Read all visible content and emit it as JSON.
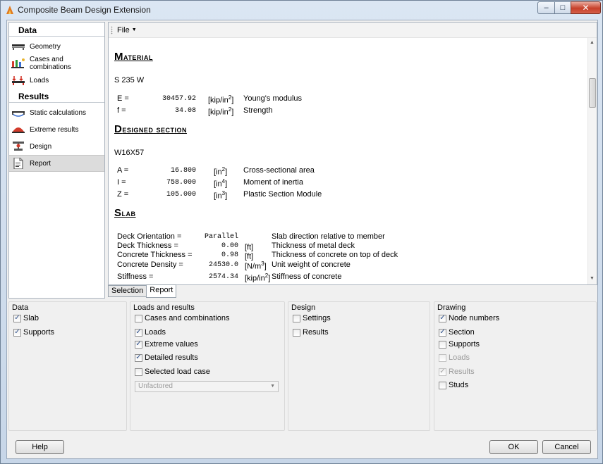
{
  "window": {
    "title": "Composite Beam Design Extension",
    "min_glyph": "–",
    "max_glyph": "□",
    "close_glyph": "✕"
  },
  "sidebar": {
    "data_header": "Data",
    "data_items": [
      {
        "label": "Geometry",
        "icon": "geometry-icon"
      },
      {
        "label": "Cases and combinations",
        "icon": "cases-icon"
      },
      {
        "label": "Loads",
        "icon": "loads-icon"
      }
    ],
    "results_header": "Results",
    "results_items": [
      {
        "label": "Static calculations",
        "icon": "static-icon"
      },
      {
        "label": "Extreme results",
        "icon": "extreme-icon"
      },
      {
        "label": "Design",
        "icon": "design-icon"
      },
      {
        "label": "Report",
        "icon": "report-icon",
        "active": true
      }
    ]
  },
  "report": {
    "menu_file": "File",
    "material": {
      "title_first": "M",
      "title_rest": "aterial",
      "grade": "S 235 W",
      "rows": [
        {
          "sym": "E =",
          "val": "30457.92",
          "unit": "[kip/in",
          "exp": "2",
          "unit_end": "]",
          "desc": "Young's modulus"
        },
        {
          "sym": "f =",
          "val": "34.08",
          "unit": "[kip/in",
          "exp": "2",
          "unit_end": "]",
          "desc": "Strength"
        }
      ]
    },
    "section": {
      "title_first": "D",
      "title_rest": "esigned section",
      "name": "W16X57",
      "rows": [
        {
          "sym": "A =",
          "val": "16.800",
          "unit": "[in",
          "exp": "2",
          "unit_end": "]",
          "desc": "Cross-sectional area"
        },
        {
          "sym": "I =",
          "val": "758.000",
          "unit": "[in",
          "exp": "4",
          "unit_end": "]",
          "desc": "Moment of inertia"
        },
        {
          "sym": "Z =",
          "val": "105.000",
          "unit": "[in",
          "exp": "3",
          "unit_end": "]",
          "desc": "Plastic Section Module"
        }
      ]
    },
    "slab": {
      "title_first": "S",
      "title_rest": "lab",
      "rows": [
        {
          "sym": "Deck Orientation =",
          "val": "Parallel",
          "unit": "",
          "exp": "",
          "unit_end": "",
          "desc": "Slab direction relative to member"
        },
        {
          "sym": "Deck Thickness =",
          "val": "0.00",
          "unit": "[ft]",
          "exp": "",
          "unit_end": "",
          "desc": "Thickness of metal deck"
        },
        {
          "sym": "Concrete Thickness =",
          "val": "0.98",
          "unit": "[ft]",
          "exp": "",
          "unit_end": "",
          "desc": "Thickness of concrete on top of deck"
        },
        {
          "sym": "Concrete Density =",
          "val": "24530.0",
          "unit": "[N/m",
          "exp": "3",
          "unit_end": "]",
          "desc": "Unit weight of concrete"
        },
        {
          "sym": "Stiffness =",
          "val": "2574.34",
          "unit": "[kip/in",
          "exp": "2",
          "unit_end": "]",
          "desc": "Stiffness of concrete"
        }
      ]
    }
  },
  "tabs": [
    "Selection",
    "Report"
  ],
  "groups": {
    "data": {
      "title": "Data",
      "items": [
        {
          "label": "Slab",
          "checked": true
        },
        {
          "label": "Supports",
          "checked": true
        }
      ]
    },
    "loads": {
      "title": "Loads and results",
      "items": [
        {
          "label": "Cases and combinations",
          "checked": false
        },
        {
          "label": "Loads",
          "checked": true
        },
        {
          "label": "Extreme values",
          "checked": true
        },
        {
          "label": "Detailed results",
          "checked": true
        },
        {
          "label": "Selected load case",
          "checked": false
        }
      ],
      "select_value": "Unfactored"
    },
    "design": {
      "title": "Design",
      "items": [
        {
          "label": "Settings",
          "checked": false
        },
        {
          "label": "Results",
          "checked": false
        }
      ]
    },
    "drawing": {
      "title": "Drawing",
      "items": [
        {
          "label": "Node numbers",
          "checked": true
        },
        {
          "label": "Section",
          "checked": true
        },
        {
          "label": "Supports",
          "checked": false
        },
        {
          "label": "Loads",
          "checked": false,
          "disabled": true
        },
        {
          "label": "Results",
          "checked": true,
          "disabled": true
        },
        {
          "label": "Studs",
          "checked": false
        }
      ]
    }
  },
  "buttons": {
    "help": "Help",
    "ok": "OK",
    "cancel": "Cancel"
  },
  "check_glyph": "✓",
  "colors": {
    "accent_check": "#2d4f8a",
    "title_gradient_top": "#dbe6f3",
    "close_red": "#c7402a"
  }
}
